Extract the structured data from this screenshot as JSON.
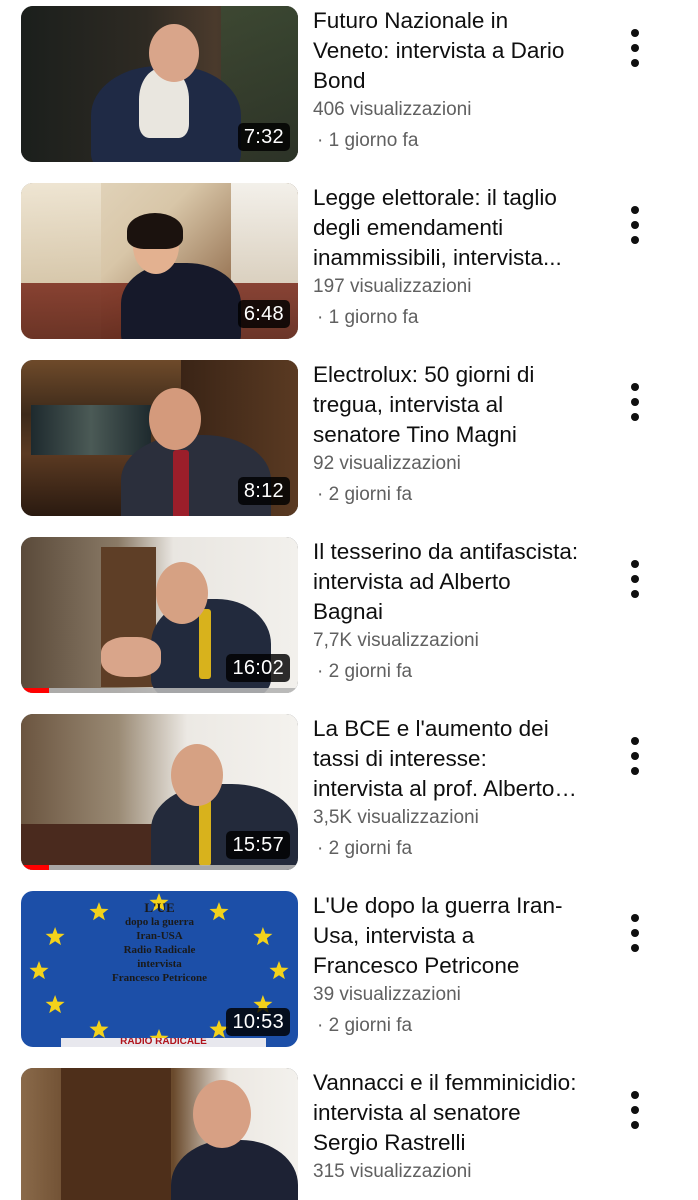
{
  "videos": [
    {
      "title": "Futuro Nazionale in Veneto: intervista a Dario Bond",
      "views": "406 visualizzazioni",
      "age": "· 1 giorno fa",
      "duration": "7:32",
      "progress": 0
    },
    {
      "title": "Legge elettorale: il taglio degli emendamenti inammissibili, intervista...",
      "views": "197 visualizzazioni",
      "age": "· 1 giorno fa",
      "duration": "6:48",
      "progress": 0
    },
    {
      "title": "Electrolux: 50 giorni di tregua, intervista al senatore Tino Magni",
      "views": "92 visualizzazioni",
      "age": "· 2 giorni fa",
      "duration": "8:12",
      "progress": 0
    },
    {
      "title": "Il tesserino da antifascista: intervista ad Alberto Bagnai",
      "views": "7,7K visualizzazioni",
      "age": "· 2 giorni fa",
      "duration": "16:02",
      "progress": 0.1
    },
    {
      "title": "La BCE e l'aumento dei tassi di interesse: intervista al prof. Alberto Bagnai",
      "views": "3,5K visualizzazioni",
      "age": "· 2 giorni fa",
      "duration": "15:57",
      "progress": 0.1
    },
    {
      "title": "L'Ue dopo la guerra Iran-Usa, intervista a Francesco Petricone",
      "views": "39 visualizzazioni",
      "age": "· 2 giorni fa",
      "duration": "10:53",
      "progress": 0,
      "thumb_text": [
        "L'UE",
        "dopo la guerra",
        "Iran-USA",
        "Radio Radicale",
        "intervista",
        "Francesco Petricone"
      ],
      "thumb_footer": "RADIO RADICALE"
    },
    {
      "title": "Vannacci e il femminicidio: intervista al senatore Sergio Rastrelli",
      "views": "315 visualizzazioni",
      "age": "",
      "duration": "",
      "progress": 0
    }
  ],
  "colors": {
    "title": "#0f0f0f",
    "meta": "#606060",
    "progress": "#ff0000",
    "eu_blue": "#1c4fa8",
    "eu_star": "#f3d21b"
  },
  "icons": {
    "menu": "more-vertical-icon"
  }
}
